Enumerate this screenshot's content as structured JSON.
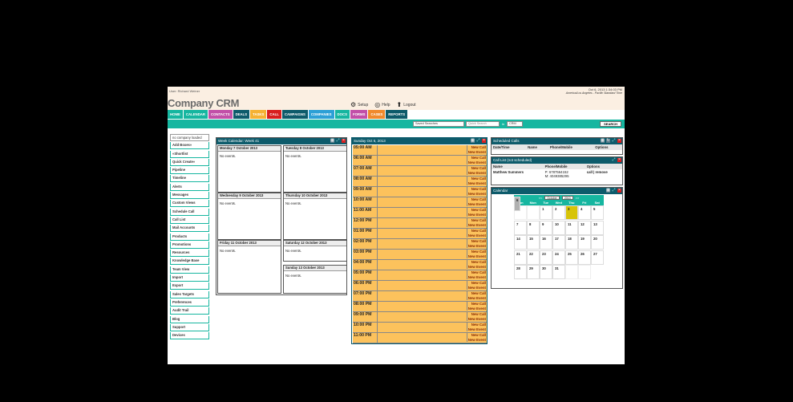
{
  "header": {
    "user": "User: Richard Weiner",
    "date": "Oct 6, 2013 1:34:03 PM",
    "timezone": "America/Los Angeles - Pacific Standard Time",
    "logo": "Company CRM",
    "links": [
      "Setup",
      "Help",
      "Logout"
    ]
  },
  "nav": [
    {
      "label": "HOME",
      "color": "#16b6a0"
    },
    {
      "label": "CALENDAR",
      "color": "#16b6a0"
    },
    {
      "label": "CONTACTS",
      "color": "#c24fa8"
    },
    {
      "label": "DEALS",
      "color": "#0d5b6b"
    },
    {
      "label": "TASKS",
      "color": "#f5b233"
    },
    {
      "label": "CALL",
      "color": "#d81e1e"
    },
    {
      "label": "CAMPAIGNS",
      "color": "#0d5b6b"
    },
    {
      "label": "COMPANIES",
      "color": "#2da0d6"
    },
    {
      "label": "DOCS",
      "color": "#16b6a0"
    },
    {
      "label": "FORMS",
      "color": "#c24fa8"
    },
    {
      "label": "CASES",
      "color": "#f08a2c"
    },
    {
      "label": "REPORTS",
      "color": "#0d5b6b"
    }
  ],
  "search": {
    "saved": "Saved Searches",
    "quick_placeholder": "Quick Search",
    "in_label": "in",
    "scope": "CRM",
    "button": "SEARCH"
  },
  "sidebar": [
    "no company loaded",
    "Add Boxes»",
    "«Shortlist",
    "Quick Create»",
    "Pipeline",
    "Timeline",
    "Alerts",
    "Messages",
    "Custom Views",
    "Schedule Call",
    "Call List",
    "Mail Accounts",
    "Products",
    "Promotions",
    "Resources",
    "Knowledge Base",
    "Team View",
    "Import",
    "Export",
    "Sales Targets",
    "Preferences",
    "Audit Trail",
    "Blog",
    "Support",
    "Devices"
  ],
  "week": {
    "title": "Week Calendar: Week 41",
    "days": [
      {
        "label": "Monday 7 October 2013",
        "events": "No events."
      },
      {
        "label": "Tuesday 8 October 2013",
        "events": "No events."
      },
      {
        "label": "Wednesday 9 October 2013",
        "events": "No events."
      },
      {
        "label": "Thursday 10 October 2013",
        "events": "No events."
      },
      {
        "label": "Friday 11 October 2013",
        "events": "No events."
      },
      {
        "label": "Saturday 12 October 2013",
        "events": "No events."
      },
      {
        "label": "Sunday 13 October 2013",
        "events": "No events."
      }
    ]
  },
  "day": {
    "title": "Sunday Oct 6, 2013",
    "hours": [
      "05:00 AM",
      "06:00 AM",
      "07:00 AM",
      "08:00 AM",
      "09:00 AM",
      "10:00 AM",
      "11:00 AM",
      "12:00 PM",
      "01:00 PM",
      "02:00 PM",
      "03:00 PM",
      "04:00 PM",
      "05:00 PM",
      "06:00 PM",
      "07:00 PM",
      "08:00 PM",
      "09:00 PM",
      "10:00 PM",
      "11:00 PM"
    ],
    "action1": "New Call",
    "action2": "New Event"
  },
  "scheduled": {
    "title": "Scheduled Calls",
    "cols": [
      "Date/Time",
      "Name",
      "Phone/Mobile",
      "Options"
    ]
  },
  "calllist": {
    "title": "Call List (not scheduled)",
    "cols": [
      "Name",
      "Phone/Mobile",
      "Options"
    ],
    "row": {
      "name": "Matthew Summers",
      "phone": "P: 6787564152",
      "mobile": "M: 4049385295",
      "options": "call | remove"
    }
  },
  "calendar": {
    "title": "Calendar",
    "prev": "<<",
    "next": ">>",
    "month": "October",
    "year": "2013",
    "weekdays": [
      "Sun",
      "Mon",
      "Tue",
      "Wed",
      "Thu",
      "Fri",
      "Sat"
    ],
    "cells": [
      "",
      "",
      "1",
      "2",
      "3",
      "4",
      "5",
      "6",
      "7",
      "8",
      "9",
      "10",
      "11",
      "12",
      "13",
      "14",
      "15",
      "16",
      "17",
      "18",
      "19",
      "20",
      "21",
      "22",
      "23",
      "24",
      "25",
      "26",
      "27",
      "28",
      "29",
      "30",
      "31",
      "",
      ""
    ],
    "today": "3",
    "selected": "6"
  }
}
